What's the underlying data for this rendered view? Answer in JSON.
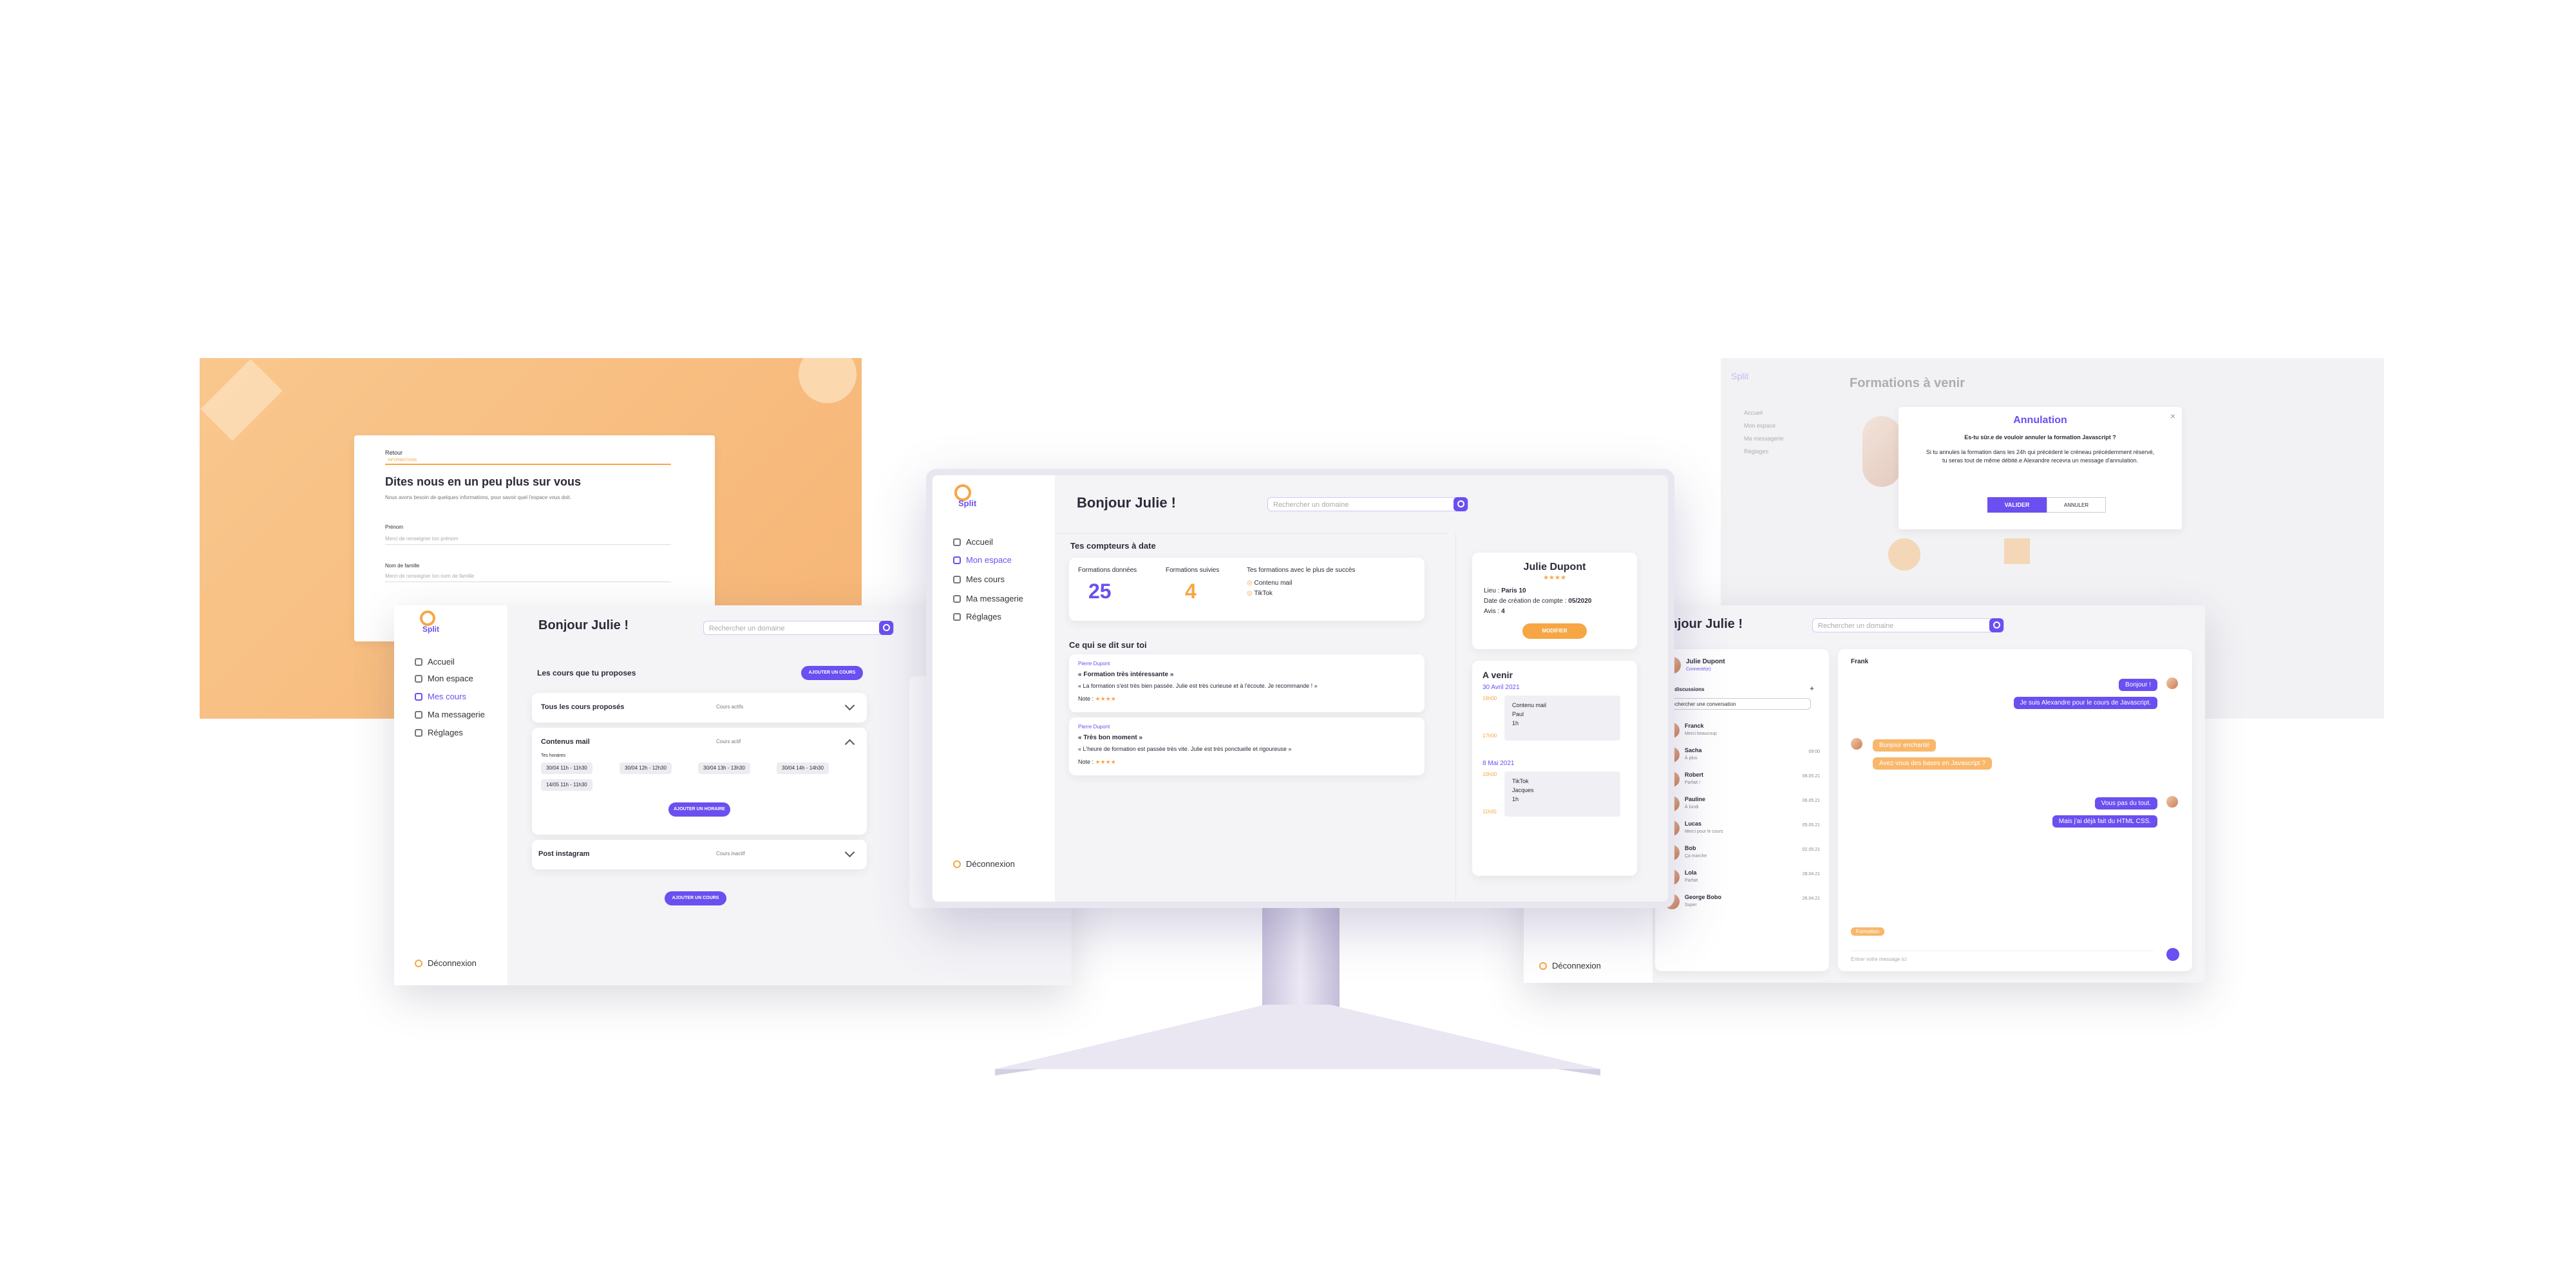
{
  "brand": {
    "logo": "Split",
    "accent": "#6b4ff0",
    "secondary": "#f6a645"
  },
  "nav": {
    "home": "Accueil",
    "space": "Mon espace",
    "courses": "Mes cours",
    "messages": "Ma messagerie",
    "settings": "Réglages",
    "logout": "Déconnexion"
  },
  "search": {
    "placeholder": "Rechercher un domaine"
  },
  "onboarding": {
    "back": "Retour",
    "progress_label": "INFORMATIONS",
    "title": "Dites nous en un peu plus sur vous",
    "subtitle": "Nous avons besoin de quelques informations, pour savoir quel l'espace vous doit.",
    "first_name_label": "Prénom",
    "first_name_placeholder": "Merci de renseigner ton prénom",
    "last_name_label": "Nom de famille",
    "last_name_placeholder": "Merci de renseigner ton nom de famille"
  },
  "cancel_modal": {
    "page_title": "Formations à venir",
    "title": "Annulation",
    "question": "Es-tu sûr.e de vouloir annuler la formation Javascript ?",
    "body": "Si tu annules la formation dans les 24h qui précèdent le créneau précédemment réservé, tu seras tout de même débité.e Alexandre recevra un message d'annulation.",
    "confirm": "VALIDER",
    "cancel": "ANNULER"
  },
  "dashboard": {
    "greeting": "Bonjour Julie !",
    "counters_title": "Tes compteurs à date",
    "given_label": "Formations données",
    "given_value": "25",
    "followed_label": "Formations suivies",
    "followed_value": "4",
    "success_title": "Tes formations avec le plus de succès",
    "success_items": [
      "Contenu mail",
      "TikTok"
    ],
    "reviews_title": "Ce qui se dit sur toi",
    "reviews": [
      {
        "author": "Pierre Dupont",
        "title": "« Formation très intéressante »",
        "text": "« La formation s'est très bien passée. Julie est très curieuse et à l'écoute. Je recommande ! »",
        "note": "Note :"
      },
      {
        "author": "Pierre Dupont",
        "title": "« Très bon moment »",
        "text": "« L'heure de formation est passée très vite. Julie est très ponctuelle et rigoureuse »",
        "note": "Note :"
      }
    ],
    "stars": "★★★★",
    "profile": {
      "name": "Julie Dupont",
      "stars": "★★★★",
      "place_label": "Lieu :",
      "place": "Paris 10",
      "created_label": "Date de création de compte :",
      "created": "05/2020",
      "reviews_label": "Avis :",
      "reviews": "4",
      "button": "MODIFIER"
    },
    "upcoming_title": "A venir",
    "upcoming": [
      {
        "date": "30 Avril 2021",
        "time": "16h00",
        "lines": [
          "Contenu mail",
          "Paul",
          "1h"
        ],
        "end": "17h00"
      },
      {
        "date": "8 Mai 2021",
        "time": "10h00",
        "lines": [
          "TikTok",
          "Jacques",
          "1h"
        ],
        "end": "11h00"
      }
    ]
  },
  "courses": {
    "greeting": "Bonjour Julie !",
    "section_title": "Les cours que tu proposes",
    "add_course": "AJOUTER UN COURS",
    "all_courses": "Tous les cours proposés",
    "all_status": "Cours actifs",
    "course1": "Contenus mail",
    "course1_status": "Cours actif",
    "slots_label": "Tes horaires",
    "slots": [
      "30/04 11h - 11h30",
      "30/04 12h - 12h30",
      "30/04 13h - 13h30",
      "30/04 14h - 14h30",
      "14/05 11h - 11h30"
    ],
    "add_slot": "AJOUTER UN HORAIRE",
    "course2": "Post instagram",
    "course2_status": "Cours inactif"
  },
  "messaging": {
    "greeting": "Bonjour Julie !",
    "user_name": "Julie Dupont",
    "user_status": "Connecté(e)",
    "conversations_title": "Vos discussions",
    "search_conv": "Rechercher une conversation",
    "contacts": [
      {
        "name": "Franck",
        "preview": "Merci beaucoup",
        "time": ""
      },
      {
        "name": "Sacha",
        "preview": "À plus",
        "time": "09:00"
      },
      {
        "name": "Robert",
        "preview": "Parfait !",
        "time": "08.05.21"
      },
      {
        "name": "Pauline",
        "preview": "À lundi",
        "time": "06.05.21"
      },
      {
        "name": "Lucas",
        "preview": "Merci pour le cours",
        "time": "05.05.21"
      },
      {
        "name": "Bob",
        "preview": "Ça marche",
        "time": "02.05.21"
      },
      {
        "name": "Lola",
        "preview": "Parfait",
        "time": "28.04.21"
      },
      {
        "name": "George Bobo",
        "preview": "Super",
        "time": "26.04.21"
      }
    ],
    "chat_with": "Frank",
    "msgs_out1": [
      "Bonjour !",
      "Je suis Alexandre pour le cours de Javascript."
    ],
    "msgs_in": [
      "Bonjour enchanté",
      "Avez-vous des bases en Javascript ?"
    ],
    "msgs_out2": [
      "Vous pas du tout.",
      "Mais j'ai déjà fait du HTML CSS."
    ],
    "tag": "Formation",
    "input_placeholder": "Entrer votre message ici"
  }
}
